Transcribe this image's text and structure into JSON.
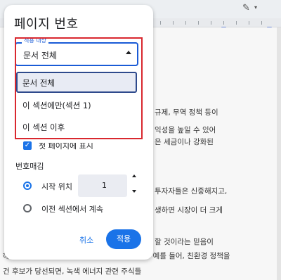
{
  "dialog": {
    "title": "페이지 번호",
    "apply_to_label": "적용 내상",
    "apply_to_value": "문서 전체",
    "options": [
      "문서 전체",
      "이 섹션에만(섹션 1)",
      "이 섹션 이후"
    ],
    "selected_option": "문서 전체",
    "show_first_page_label": "첫 페이지에 표시",
    "numbering_label": "번호매김",
    "start_at_label": "시작 위치",
    "start_at_value": "1",
    "continue_label": "이전 섹션에서 계속",
    "cancel_label": "취소",
    "apply_label": "적용"
  },
  "document_lines": [
    "규제, 무역 정책 등이",
    "익성을 높일 수 있어",
    "은 세금이나 강화된",
    "투자자들은 신중해지고,",
    "생하면 시장이 더 크게",
    "할 것이라는 믿음이",
    "해지며, 특정 섹터나 주식이 상승할 수 있습니다. 예를 들어, 친환경 정책을",
    "건 후보가 당선되면, 녹색 에너지 관련 주식들"
  ],
  "colors": {
    "accent": "#1a73e8",
    "highlight": "#d9282f"
  }
}
